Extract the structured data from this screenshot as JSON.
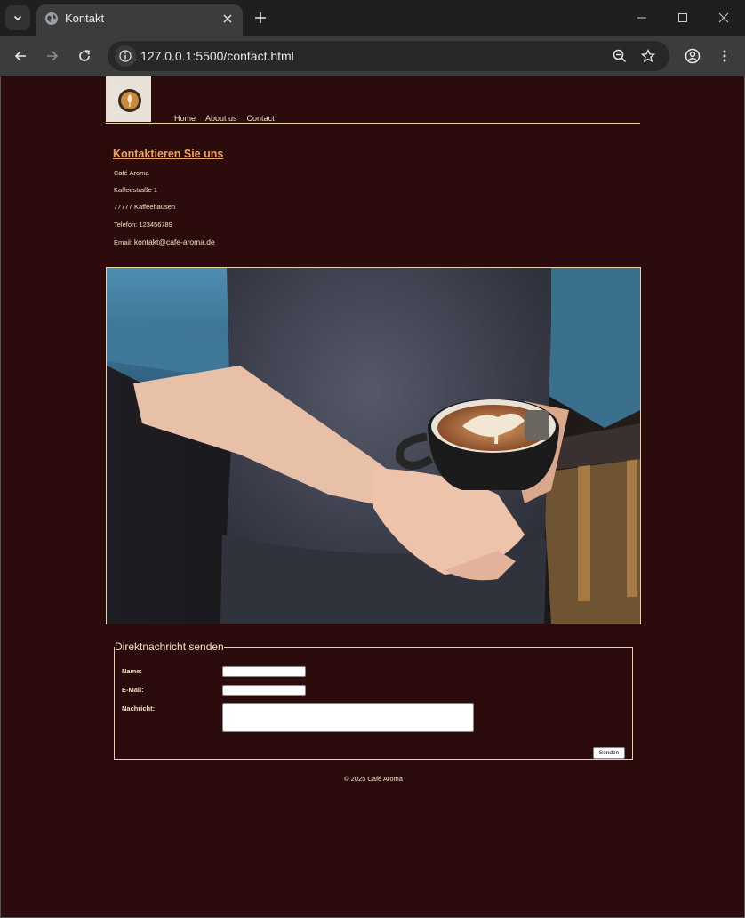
{
  "browser": {
    "tab_title": "Kontakt",
    "url_host": "127.0.0.1",
    "url_rest": ":5500/contact.html"
  },
  "site": {
    "nav": [
      "Home",
      "About us",
      "Contact"
    ]
  },
  "contact": {
    "title": "Kontaktieren Sie uns",
    "name": "Café Aroma",
    "street": "Kaffeestraße 1",
    "city": "77777 Kaffeehausen",
    "phone": "Telefon: 123456789",
    "email_label": "Email: ",
    "email": "kontakt@cafe-aroma.de"
  },
  "form": {
    "legend": "Direktnachricht senden",
    "name_label": "Name:",
    "email_label": "E-Mail:",
    "message_label": "Nachricht:",
    "submit": "Senden"
  },
  "footer": {
    "text": "© 2025 Café Aroma"
  },
  "colors": {
    "page_bg": "#2b0b0c",
    "text": "#f2e4c4",
    "accent": "#f0a35a"
  }
}
